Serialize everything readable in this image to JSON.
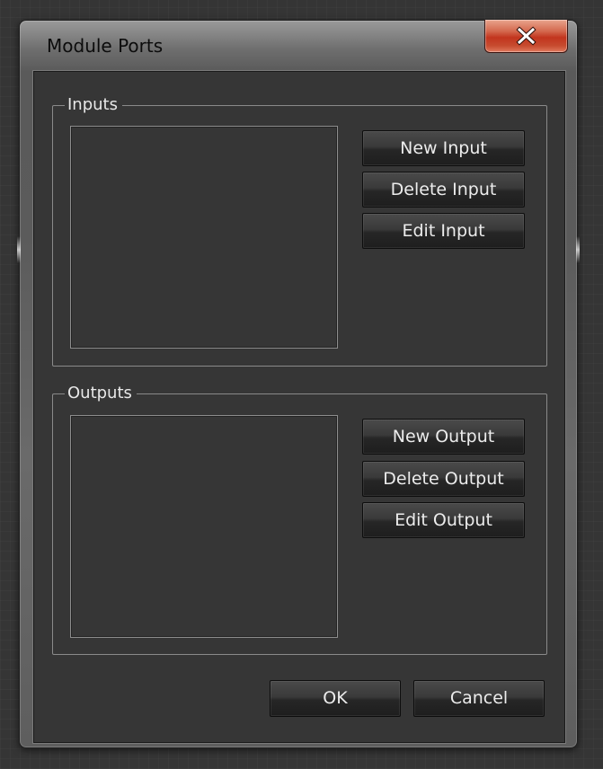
{
  "window": {
    "title": "Module Ports"
  },
  "inputs": {
    "legend": "Inputs",
    "items": [],
    "buttons": {
      "new": "New Input",
      "delete": "Delete Input",
      "edit": "Edit Input"
    }
  },
  "outputs": {
    "legend": "Outputs",
    "items": [],
    "buttons": {
      "new": "New Output",
      "delete": "Delete Output",
      "edit": "Edit Output"
    }
  },
  "dialog_buttons": {
    "ok": "OK",
    "cancel": "Cancel"
  },
  "colors": {
    "client_background": "#363636",
    "button_text": "#ececec",
    "close_button": "#c2351e"
  },
  "icons": {
    "close": "close-icon"
  }
}
